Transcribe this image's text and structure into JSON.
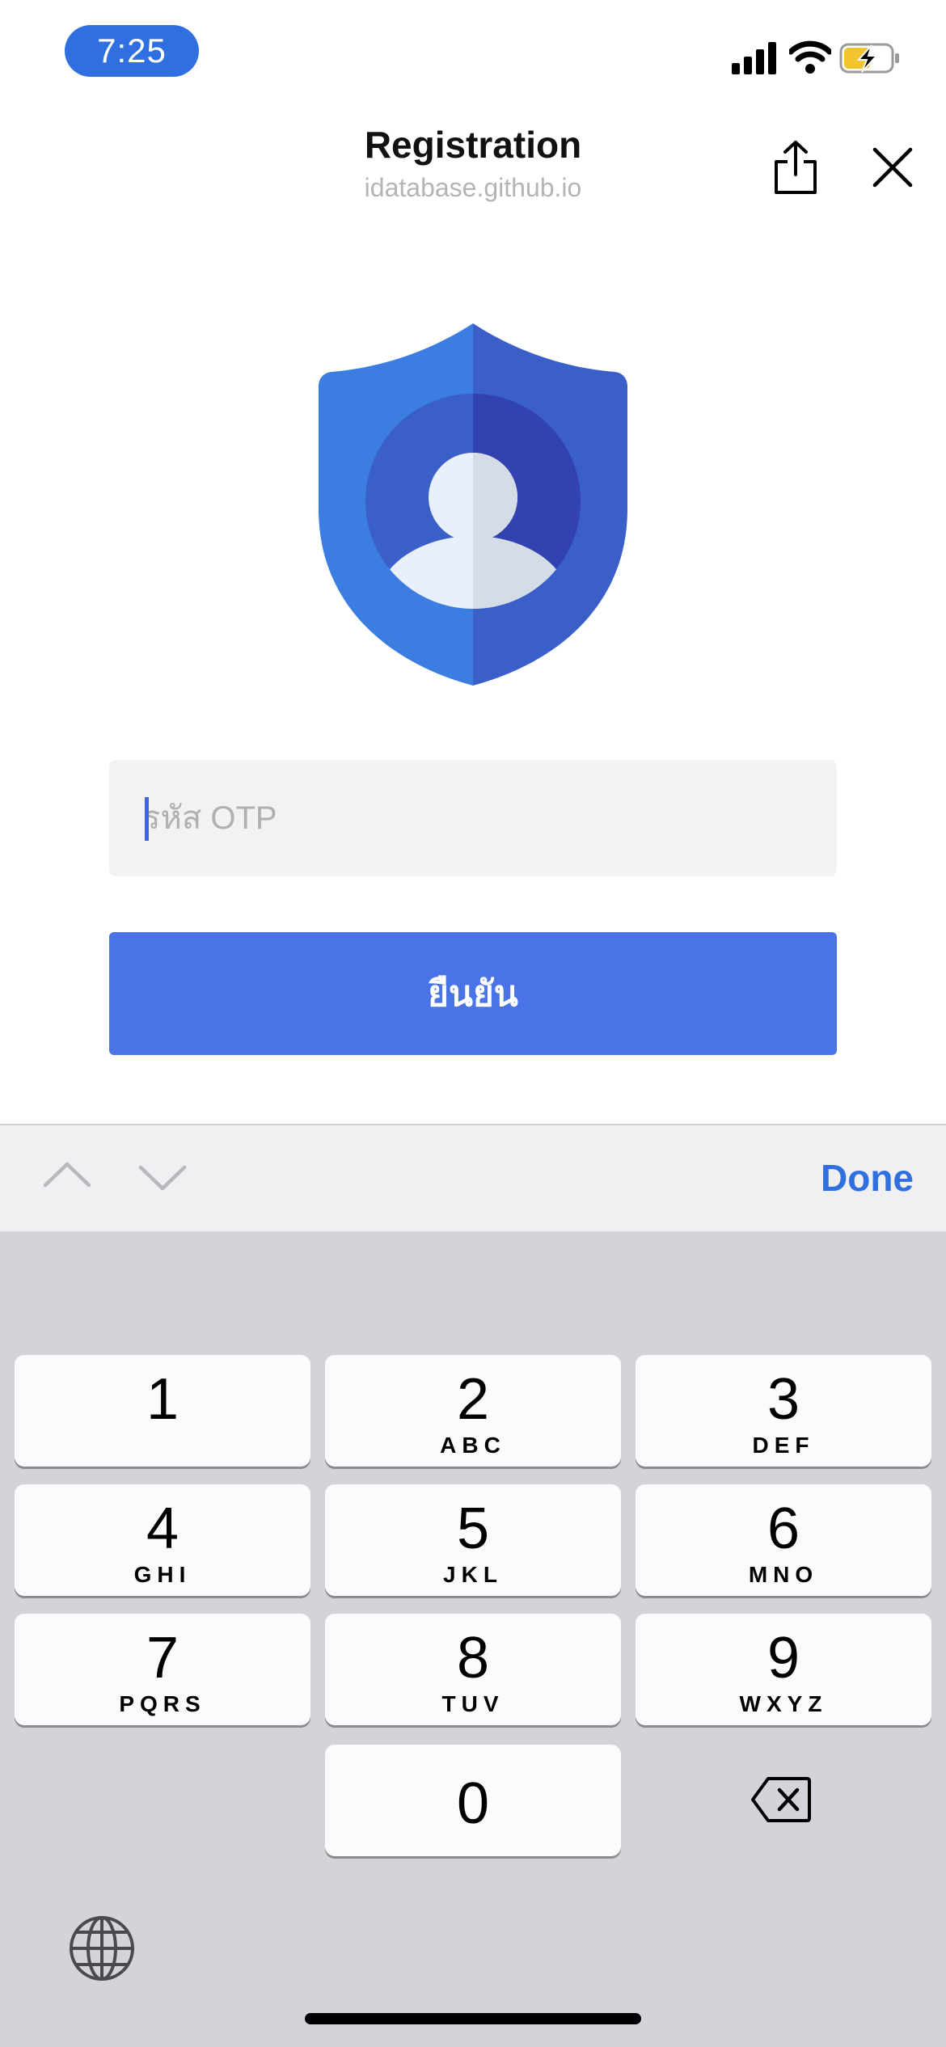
{
  "status_bar": {
    "time": "7:25"
  },
  "header": {
    "title": "Registration",
    "subtitle": "idatabase.github.io"
  },
  "form": {
    "otp_placeholder": "รหัส OTP",
    "otp_value": "",
    "confirm_label": "ยืนยัน"
  },
  "accessory": {
    "done_label": "Done"
  },
  "keypad": {
    "keys": [
      {
        "digit": "1",
        "letters": ""
      },
      {
        "digit": "2",
        "letters": "ABC"
      },
      {
        "digit": "3",
        "letters": "DEF"
      },
      {
        "digit": "4",
        "letters": "GHI"
      },
      {
        "digit": "5",
        "letters": "JKL"
      },
      {
        "digit": "6",
        "letters": "MNO"
      },
      {
        "digit": "7",
        "letters": "PQRS"
      },
      {
        "digit": "8",
        "letters": "TUV"
      },
      {
        "digit": "9",
        "letters": "WXYZ"
      },
      {
        "digit": "0",
        "letters": ""
      }
    ]
  },
  "colors": {
    "accent": "#2f6fe0",
    "button": "#4a74e6",
    "shield_light": "#3b7de0",
    "shield_dark": "#3a5fc8"
  },
  "icons": [
    "signal-icon",
    "wifi-icon",
    "battery-charging-icon",
    "share-icon",
    "close-icon",
    "shield-user-icon",
    "chevron-up-icon",
    "chevron-down-icon",
    "delete-icon",
    "globe-icon"
  ]
}
